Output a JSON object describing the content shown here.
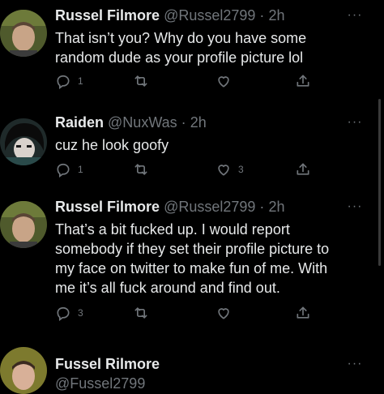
{
  "tweets": [
    {
      "name": "Russel Filmore",
      "handle": "@Russel2799",
      "separator": "·",
      "time": "2h",
      "text_lines": [
        "That isn’t you? Why do you have some",
        "random dude as your profile picture lol"
      ],
      "reply_count": "1",
      "retweet_count": "",
      "like_count": "",
      "more_icon": "more-dots-icon"
    },
    {
      "name": "Raiden",
      "handle": "@NuxWas",
      "separator": "·",
      "time": "2h",
      "text_lines": [
        "cuz he look goofy"
      ],
      "reply_count": "1",
      "retweet_count": "",
      "like_count": "3",
      "more_icon": "more-dots-icon"
    },
    {
      "name": "Russel Filmore",
      "handle": "@Russel2799",
      "separator": "·",
      "time": "2h",
      "text_lines": [
        "That’s a bit fucked up. I would report",
        "somebody if they set their profile picture to",
        "my face on twitter to make fun of me. With",
        "me it’s all fuck around and find out."
      ],
      "reply_count": "3",
      "retweet_count": "",
      "like_count": "",
      "more_icon": "more-dots-icon"
    },
    {
      "name": "Fussel Rilmore",
      "handle": "@Fussel2799",
      "more_icon": "more-dots-icon"
    }
  ],
  "icons": {
    "reply": "reply-icon",
    "retweet": "retweet-icon",
    "like": "like-icon",
    "share": "share-icon"
  },
  "colors": {
    "background": "#000000",
    "text": "#e7e9ea",
    "secondary": "#71767b"
  }
}
